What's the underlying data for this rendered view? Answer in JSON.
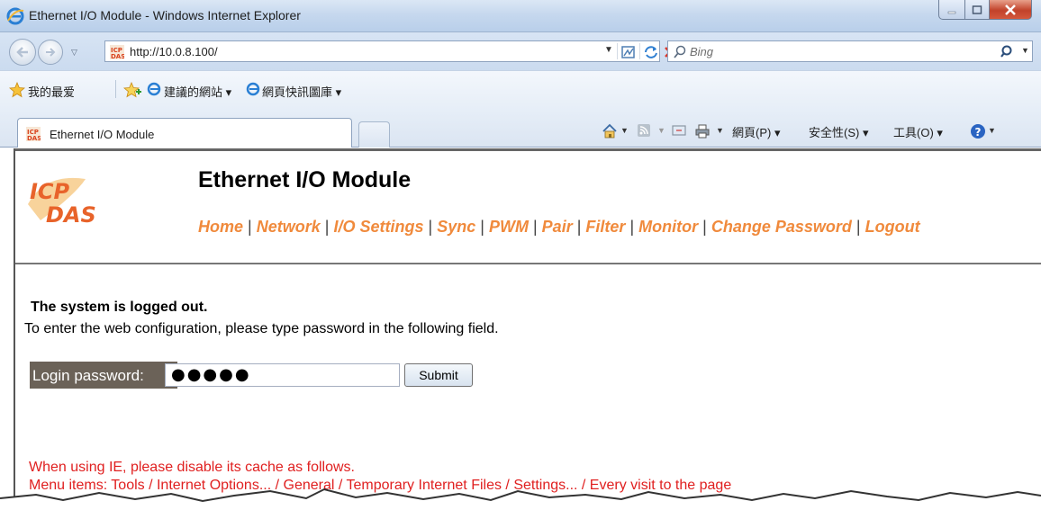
{
  "window": {
    "title": "Ethernet I/O Module - Windows Internet Explorer"
  },
  "address_bar": {
    "url": "http://10.0.8.100/",
    "search_placeholder": "Bing"
  },
  "favorites_bar": {
    "favorites_label": "我的最爱",
    "items": [
      {
        "label": "建議的網站 ▾"
      },
      {
        "label": "網頁快訊圖庫 ▾"
      }
    ]
  },
  "tab": {
    "label": "Ethernet I/O Module"
  },
  "command_bar": {
    "page_menu": "網頁(P) ▾",
    "safety_menu": "安全性(S) ▾",
    "tools_menu": "工具(O) ▾"
  },
  "page": {
    "title": "Ethernet I/O Module",
    "menu": [
      {
        "label": "Home"
      },
      {
        "label": "Network"
      },
      {
        "label": "I/O Settings"
      },
      {
        "label": "Sync"
      },
      {
        "label": "PWM"
      },
      {
        "label": "Pair"
      },
      {
        "label": "Filter"
      },
      {
        "label": "Monitor"
      },
      {
        "label": "Change Password"
      },
      {
        "label": "Logout"
      }
    ],
    "menu_separator": "|",
    "status_title": "The system is logged out.",
    "status_desc": "To enter the web configuration, please type password in the following field.",
    "password_label": "Login password:",
    "password_value": "●●●●●",
    "submit_label": "Submit",
    "note_line1": "When using IE, please disable its cache as follows.",
    "note_line2": "Menu items: Tools / Internet Options... / General / Temporary Internet Files / Settings... / Every visit to the page",
    "logo_text_top": "ICP",
    "logo_text_bottom": "DAS"
  },
  "colors": {
    "menu_link": "#f08a3c",
    "password_label_bg": "#6b6258",
    "note_text": "#e02020"
  }
}
